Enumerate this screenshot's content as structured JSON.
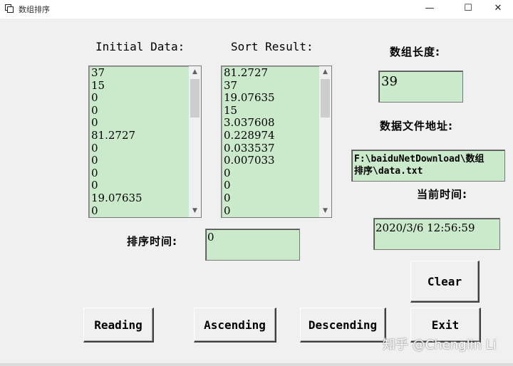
{
  "window": {
    "title": "数组排序",
    "minimize_glyph": "—",
    "maximize_glyph": "☐",
    "close_glyph": "✕"
  },
  "labels": {
    "initial_data": "Initial Data:",
    "sort_result": "Sort Result:",
    "array_length": "数组长度:",
    "data_file_path": "数据文件地址:",
    "current_time": "当前时间:",
    "sort_time": "排序时间:"
  },
  "initial_list": [
    "37",
    "15",
    "0",
    "0",
    "0",
    "81.2727",
    "0",
    "0",
    "0",
    "0",
    "19.07635",
    "0"
  ],
  "sort_list": [
    "81.2727",
    "37",
    "19.07635",
    "15",
    "3.037608",
    "0.228974",
    "0.033537",
    "0.007033",
    "0",
    "0",
    "0",
    "0"
  ],
  "fields": {
    "array_length_value": "39",
    "file_path_value_line1": "F:\\baiduNetDownload\\数组",
    "file_path_value_line2": "排序\\data.txt",
    "current_time_value": "2020/3/6 12:56:59",
    "sort_time_value": "0"
  },
  "buttons": {
    "clear": "Clear",
    "reading": "Reading",
    "ascending": "Ascending",
    "descending": "Descending",
    "exit": "Exit"
  },
  "scroll": {
    "up_glyph": "▲",
    "down_glyph": "▼"
  },
  "watermark": "知乎 @Chenglin Li",
  "colors": {
    "field_background": "#cbe9cb",
    "window_background": "#f0f0f0"
  }
}
